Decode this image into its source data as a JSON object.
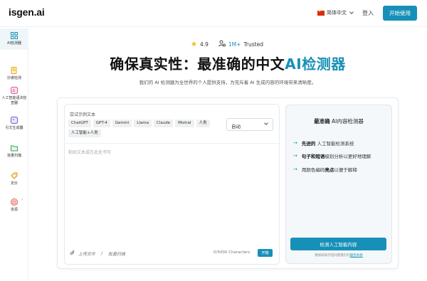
{
  "header": {
    "logo": "isgen.ai",
    "language": "简体中文",
    "login": "登入",
    "start": "开始使用"
  },
  "sidebar": {
    "items": [
      {
        "label": "AI检测器",
        "icon": "grid-icon"
      },
      {
        "label": "抄袭检测",
        "icon": "search-doc-icon"
      },
      {
        "label": "人工智能语法检查器",
        "icon": "grammar-icon"
      },
      {
        "label": "引文生成器",
        "icon": "quote-icon"
      },
      {
        "label": "批量扫描",
        "icon": "folder-icon"
      },
      {
        "label": "定价",
        "icon": "tag-icon"
      },
      {
        "label": "资源",
        "icon": "book-icon"
      }
    ]
  },
  "hero": {
    "rating": "4.9",
    "trusted_num": "1M+",
    "trusted_text": "Trusted",
    "title_main": "确保真实性：最准确的中文",
    "title_accent": "AI检测器",
    "subtitle": "我们的 AI 检测器为全世界的个人提供支持，为充斥着 AI 生成内容的环境带来清晰度。"
  },
  "editor": {
    "try_label": "尝试示例文本",
    "chips": [
      "ChatGPT",
      "GPT-4",
      "Gemini",
      "Llama",
      "Claude",
      "Mistral",
      "人类",
      "人工智能+人类"
    ],
    "mode": "自动",
    "placeholder": "粘贴文本或在此处书写",
    "upload": "上传文件",
    "separator": "/",
    "batch": "批量扫描",
    "counter": "0/5000 Characters",
    "submit": "开箱"
  },
  "panel": {
    "title_bold": "最准确",
    "title_rest": " AI内容检测器",
    "features": [
      {
        "bold": "先进的",
        "rest": "人工智能检测系统"
      },
      {
        "bold": "句子和短语",
        "rest": "级别分析以更好地理解"
      },
      {
        "bold": "亮点",
        "pre": "用颜色编码",
        "rest": "以便于解释"
      }
    ],
    "button": "检测人工智能内容",
    "terms_pre": "继续即表示您同意我们的",
    "terms_link": "服务条款"
  },
  "colors": {
    "accent": "#1790b8",
    "star": "#f5b700"
  }
}
